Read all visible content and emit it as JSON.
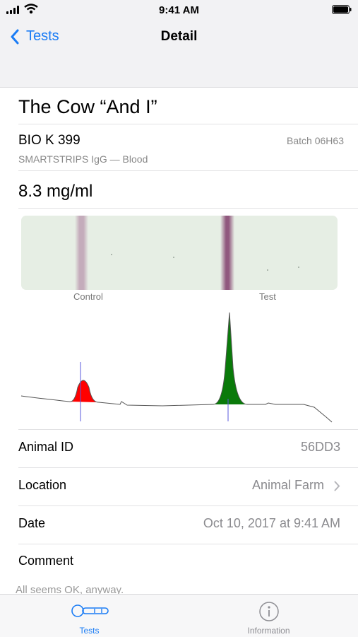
{
  "status": {
    "time": "9:41 AM"
  },
  "nav": {
    "back_label": "Tests",
    "title": "Detail"
  },
  "test": {
    "title": "The Cow “And I”",
    "product": "BIO K 399",
    "batch": "Batch 06H63",
    "kind": "SMARTSTRIPS IgG — Blood",
    "result": "8.3 mg/ml"
  },
  "strip": {
    "control_label": "Control",
    "test_label": "Test"
  },
  "chart_data": {
    "type": "area",
    "title": "",
    "xlabel": "",
    "ylabel": "",
    "peaks": [
      {
        "label": "Control",
        "color": "#ff0000",
        "relative_position": 0.19,
        "relative_height": 0.27
      },
      {
        "label": "Test",
        "color": "#0a7a0a",
        "relative_position": 0.66,
        "relative_height": 1.0
      }
    ]
  },
  "details": [
    {
      "label": "Animal ID",
      "value": "56DD3",
      "chevron": false
    },
    {
      "label": "Location",
      "value": "Animal Farm",
      "chevron": true
    },
    {
      "label": "Date",
      "value": "Oct 10, 2017 at 9:41 AM",
      "chevron": false
    },
    {
      "label": "Comment",
      "value": "",
      "chevron": false
    }
  ],
  "comment_text": "All seems OK, anyway.",
  "tabs": [
    {
      "label": "Tests",
      "active": true,
      "icon": "test-strip-icon"
    },
    {
      "label": "Information",
      "active": false,
      "icon": "info-icon"
    }
  ],
  "colors": {
    "accent": "#1a7cf5",
    "control_peak": "#ff0000",
    "test_peak": "#0a7a0a"
  }
}
